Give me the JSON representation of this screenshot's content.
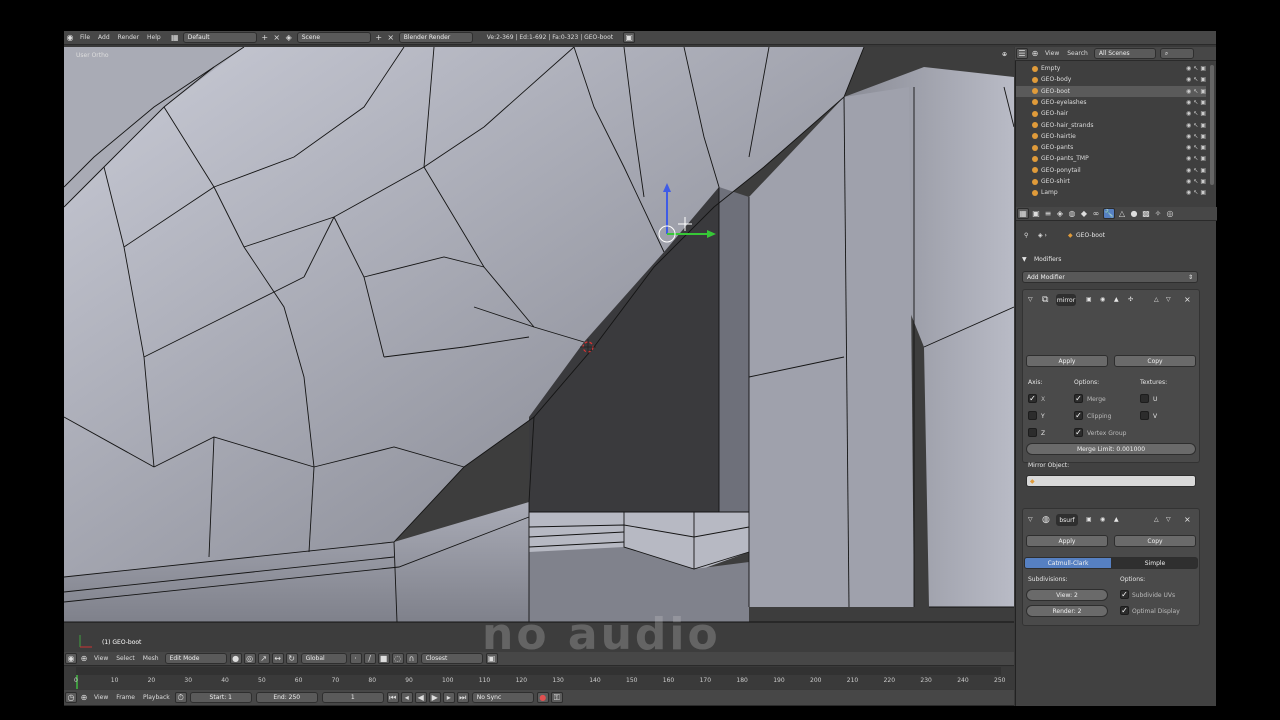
{
  "top_bar": {
    "menus": [
      "File",
      "Add",
      "Render",
      "Help"
    ],
    "layout": "Default",
    "scene": "Scene",
    "engine": "Blender Render",
    "stats": "Ve:2-369 | Ed:1-692 | Fa:0-323 | GEO-boot"
  },
  "viewport": {
    "view_label": "User Ortho",
    "object_label": "(1) GEO-boot",
    "watermark": "no audio"
  },
  "view_header": {
    "menus": [
      "View",
      "Select",
      "Mesh"
    ],
    "mode": "Edit Mode",
    "orientation": "Global",
    "snap": "Closest"
  },
  "timeline": {
    "ticks": [
      "0",
      "10",
      "20",
      "30",
      "40",
      "50",
      "60",
      "70",
      "80",
      "90",
      "100",
      "110",
      "120",
      "130",
      "140",
      "150",
      "160",
      "170",
      "180",
      "190",
      "200",
      "210",
      "220",
      "230",
      "240",
      "250"
    ]
  },
  "timeline_header": {
    "menus": [
      "View",
      "Frame",
      "Playback"
    ],
    "start": "Start: 1",
    "end": "End: 250",
    "current": "1",
    "sync": "No Sync"
  },
  "outliner": {
    "menus": [
      "View",
      "Search"
    ],
    "filter": "All Scenes",
    "items": [
      "Empty",
      "GEO-body",
      "GEO-boot",
      "GEO-eyelashes",
      "GEO-hair",
      "GEO-hair_strands",
      "GEO-hairtie",
      "GEO-pants",
      "GEO-pants_TMP",
      "GEO-ponytail",
      "GEO-shirt",
      "Lamp"
    ]
  },
  "properties": {
    "breadcrumb": "GEO-boot",
    "section": "Modifiers",
    "add_modifier": "Add Modifier",
    "mirror": {
      "name": "mirror",
      "apply": "Apply",
      "copy": "Copy",
      "axis_label": "Axis:",
      "options_label": "Options:",
      "textures_label": "Textures:",
      "axes": [
        "X",
        "Y",
        "Z"
      ],
      "options": [
        "Merge",
        "Clipping",
        "Vertex Group"
      ],
      "textures": [
        "U",
        "V"
      ],
      "merge_limit": "Merge Limit: 0.001000",
      "mirror_object_label": "Mirror Object:"
    },
    "subsurf": {
      "name": "bsurf",
      "apply": "Apply",
      "copy": "Copy",
      "type_a": "Catmull-Clark",
      "type_b": "Simple",
      "subdivisions_label": "Subdivisions:",
      "options_label": "Options:",
      "view": "View: 2",
      "render": "Render: 2",
      "subdivide_uvs": "Subdivide UVs",
      "optimal_display": "Optimal Display"
    }
  },
  "colors": {
    "accent_blue": "#5680c2",
    "active_orange": "#e09b3a",
    "header": "#474747"
  }
}
